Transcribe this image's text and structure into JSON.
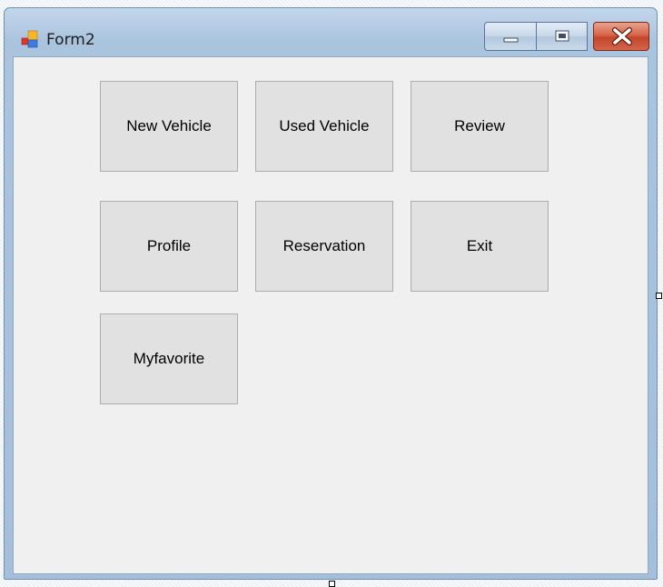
{
  "window": {
    "title": "Form2",
    "icon": "windows-forms-app-icon",
    "controls": {
      "minimize_icon": "minimize-icon",
      "maximize_icon": "maximize-icon",
      "close_icon": "close-icon"
    }
  },
  "buttons": {
    "new_vehicle": "New Vehicle",
    "used_vehicle": "Used Vehicle",
    "review": "Review",
    "profile": "Profile",
    "reservation": "Reservation",
    "exit": "Exit",
    "myfavorite": "Myfavorite"
  },
  "colors": {
    "form_background": "#f0f0f0",
    "button_face": "#e1e1e1",
    "button_border": "#adadad",
    "titlebar": "#aac4de",
    "close_button": "#c2452b"
  }
}
